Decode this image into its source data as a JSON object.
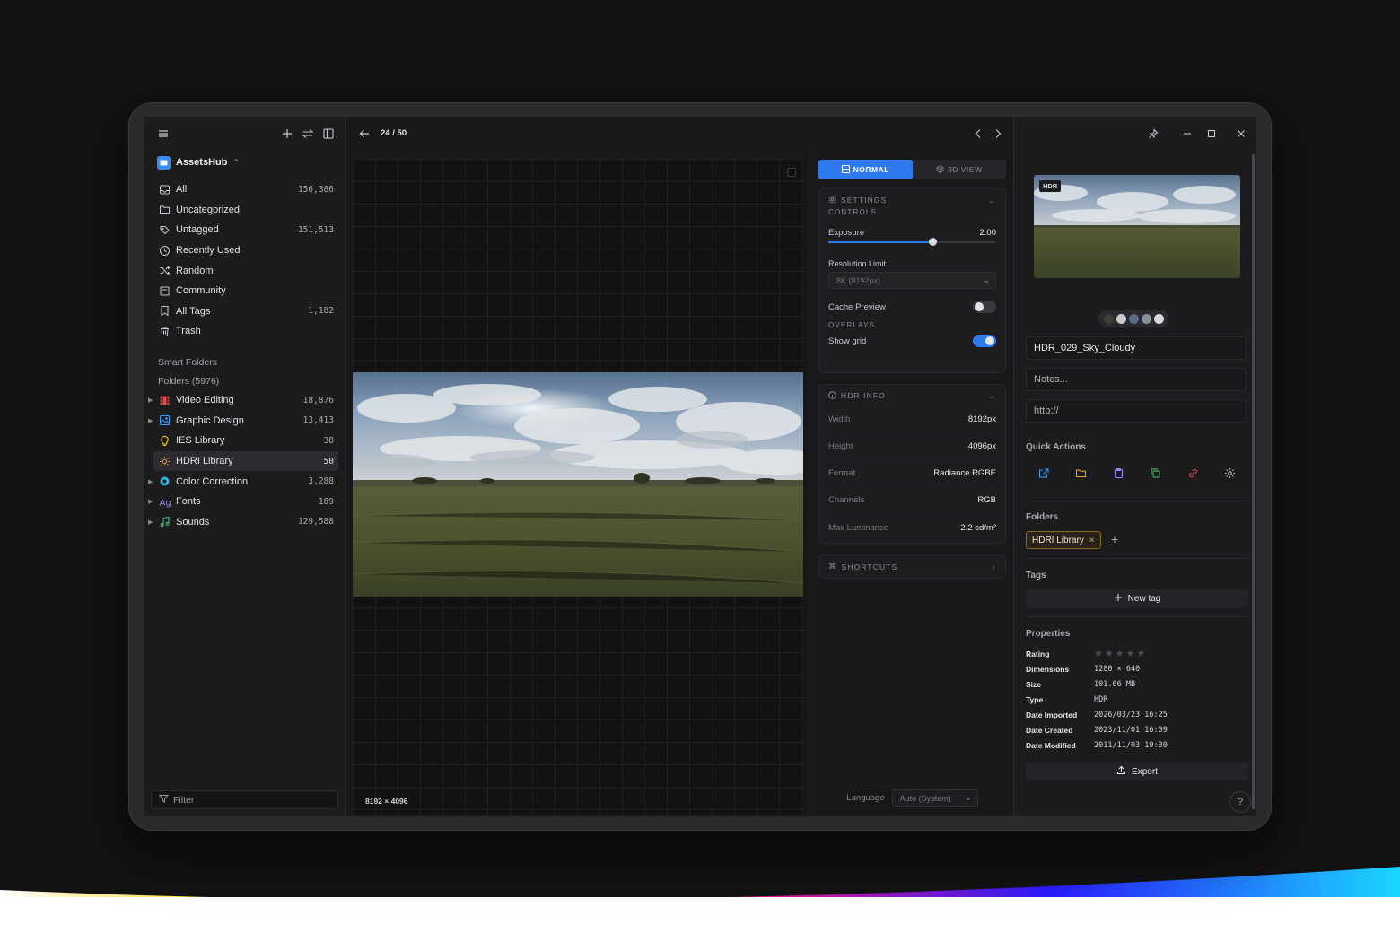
{
  "header": {
    "counter": "24 / 50"
  },
  "sidebar": {
    "workspace": "AssetsHub",
    "items": [
      {
        "label": "All",
        "count": "156,386",
        "icon": "inbox-icon"
      },
      {
        "label": "Uncategorized",
        "count": "",
        "icon": "folder-question-icon"
      },
      {
        "label": "Untagged",
        "count": "151,513",
        "icon": "tag-off-icon"
      },
      {
        "label": "Recently Used",
        "count": "",
        "icon": "clock-icon"
      },
      {
        "label": "Random",
        "count": "",
        "icon": "shuffle-icon"
      },
      {
        "label": "Community",
        "count": "",
        "icon": "community-icon"
      },
      {
        "label": "All Tags",
        "count": "1,182",
        "icon": "bookmark-icon"
      },
      {
        "label": "Trash",
        "count": "",
        "icon": "trash-icon"
      }
    ],
    "smart_folders": "Smart Folders",
    "folders_header": "Folders (5976)",
    "folders": [
      {
        "label": "Video Editing",
        "count": "18,876",
        "color": "#e5484d",
        "icon": "film-icon"
      },
      {
        "label": "Graphic Design",
        "count": "13,413",
        "color": "#3b9eff",
        "icon": "image-icon"
      },
      {
        "label": "IES Library",
        "count": "38",
        "color": "#f5d90a",
        "icon": "lightbulb-icon"
      },
      {
        "label": "HDRI Library",
        "count": "50",
        "color": "#f5a524",
        "icon": "sun-icon"
      },
      {
        "label": "Color Correction",
        "count": "3,288",
        "color": "#2fb8e0",
        "icon": "color-wheel-icon"
      },
      {
        "label": "Fonts",
        "count": "189",
        "color": "#9b8afb",
        "icon": "font-icon"
      },
      {
        "label": "Sounds",
        "count": "129,588",
        "color": "#46c96e",
        "icon": "music-icon"
      }
    ],
    "filter_placeholder": "Filter"
  },
  "viewer": {
    "dimensions": "8192 × 4096"
  },
  "settings": {
    "mode_normal": "NORMAL",
    "mode_3d": "3D VIEW",
    "settings_title": "SETTINGS",
    "controls_label": "CONTROLS",
    "exposure_label": "Exposure",
    "exposure_value": "2.00",
    "exposure_fraction": 0.62,
    "resolution_label": "Resolution Limit",
    "resolution_value": "8K (8192px)",
    "cache_label": "Cache Preview",
    "cache_on": false,
    "overlays_label": "OVERLAYS",
    "grid_label": "Show grid",
    "grid_on": true,
    "hdr_title": "HDR INFO",
    "hdr_rows": [
      {
        "k": "Width",
        "v": "8192px"
      },
      {
        "k": "Height",
        "v": "4096px"
      },
      {
        "k": "Format",
        "v": "Radiance RGBE"
      },
      {
        "k": "Channels",
        "v": "RGB"
      },
      {
        "k": "Max Luminance",
        "v": "2.2 cd/m²"
      }
    ],
    "shortcuts_title": "SHORTCUTS",
    "language_label": "Language",
    "language_value": "Auto (System)"
  },
  "inspector": {
    "badge": "HDR",
    "swatches": [
      "#3c3f33",
      "#c9ccd0",
      "#5e6888",
      "#8a8e97",
      "#d7d9dc"
    ],
    "name": "HDR_029_Sky_Cloudy",
    "notes_placeholder": "Notes...",
    "url_placeholder": "http://",
    "quick_actions_label": "Quick Actions",
    "quick_actions": [
      {
        "icon": "external-link-icon",
        "color": "#3b9eff"
      },
      {
        "icon": "folder-icon",
        "color": "#f5a524"
      },
      {
        "icon": "clipboard-icon",
        "color": "#9b8afb"
      },
      {
        "icon": "copy-icon",
        "color": "#46c96e"
      },
      {
        "icon": "link-icon",
        "color": "#e5484d"
      },
      {
        "icon": "gear-icon",
        "color": "#d0d0d4"
      }
    ],
    "folders_label": "Folders",
    "folder_chip": "HDRI Library",
    "tags_label": "Tags",
    "new_tag": "New tag",
    "properties_label": "Properties",
    "rating": 0,
    "properties": [
      {
        "k": "Rating",
        "v": ""
      },
      {
        "k": "Dimensions",
        "v": "1280 × 640"
      },
      {
        "k": "Size",
        "v": "101.66 MB"
      },
      {
        "k": "Type",
        "v": "HDR"
      },
      {
        "k": "Date Imported",
        "v": "2026/03/23 16:25"
      },
      {
        "k": "Date Created",
        "v": "2023/11/01 16:09"
      },
      {
        "k": "Date Modified",
        "v": "2011/11/03 19:30"
      }
    ],
    "export_label": "Export",
    "help": "?"
  }
}
